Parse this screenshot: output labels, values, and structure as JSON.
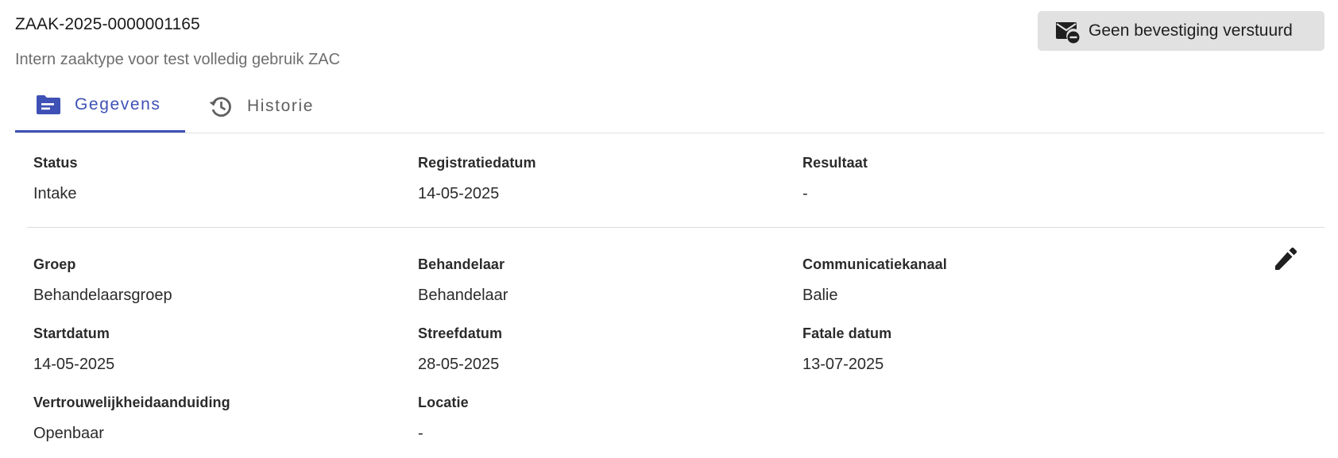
{
  "header": {
    "case_id": "ZAAK-2025-0000001165",
    "case_type": "Intern zaaktype voor test volledig gebruik ZAC",
    "confirmation_chip": {
      "label": "Geen bevestiging verstuurd",
      "icon": "mail-blocked-icon"
    }
  },
  "tabs": [
    {
      "label": "Gegevens",
      "icon": "folder-icon",
      "active": true
    },
    {
      "label": "Historie",
      "icon": "history-icon",
      "active": false
    }
  ],
  "summary": {
    "status": {
      "label": "Status",
      "value": "Intake"
    },
    "registratiedatum": {
      "label": "Registratiedatum",
      "value": "14-05-2025"
    },
    "resultaat": {
      "label": "Resultaat",
      "value": "-"
    }
  },
  "details": {
    "groep": {
      "label": "Groep",
      "value": "Behandelaarsgroep"
    },
    "behandelaar": {
      "label": "Behandelaar",
      "value": "Behandelaar"
    },
    "communicatiekanaal": {
      "label": "Communicatiekanaal",
      "value": "Balie"
    },
    "startdatum": {
      "label": "Startdatum",
      "value": "14-05-2025"
    },
    "streefdatum": {
      "label": "Streefdatum",
      "value": "28-05-2025"
    },
    "fatale_datum": {
      "label": "Fatale datum",
      "value": "13-07-2025"
    },
    "vertrouwelijkheid": {
      "label": "Vertrouwelijkheidaanduiding",
      "value": "Openbaar"
    },
    "locatie": {
      "label": "Locatie",
      "value": "-"
    },
    "edit_icon": "pencil-icon"
  },
  "colors": {
    "accent": "#3f51b5",
    "chip_background": "#e1e1e1",
    "muted_text": "#6e6e6e"
  }
}
